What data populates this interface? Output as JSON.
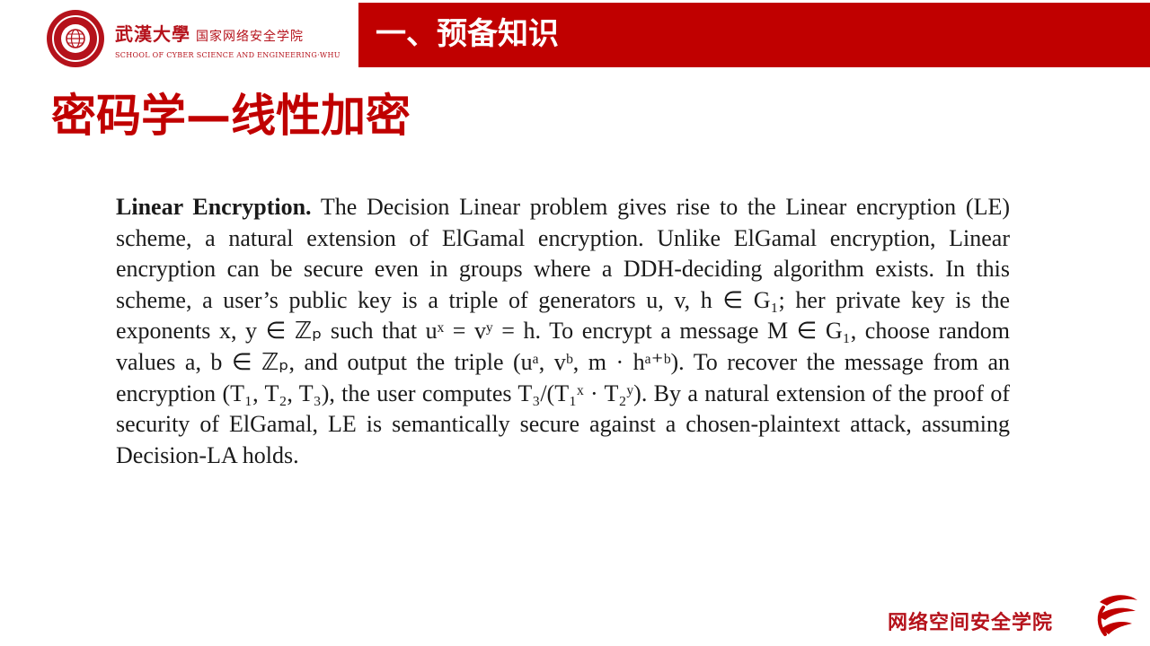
{
  "header": {
    "university_cn": "武漢大學",
    "institute_cn": "国家网络安全学院",
    "school_en": "SCHOOL OF CYBER SCIENCE AND ENGINEERING·WHU",
    "section_title": "一、预备知识"
  },
  "slide": {
    "title": "密码学—线性加密"
  },
  "body": {
    "bold_lead": "Linear Encryption.",
    "sentences": [
      "The Decision Linear problem gives rise to the Linear encryption (LE) scheme, a natural extension of ElGamal encryption.",
      "Unlike ElGamal encryption, Linear encryption can be secure even in groups where a DDH-deciding algorithm exists.",
      "In this scheme, a user’s public key is a triple of generators u, v, h ∈ G₁; her private key is the exponents x, y ∈ ℤₚ such that uˣ = vʸ = h.",
      "To encrypt a message M ∈ G₁, choose random values a, b ∈ ℤₚ, and output the triple (uᵃ, vᵇ, m · hᵃ⁺ᵇ).",
      "To recover the message from an encryption (T₁, T₂, T₃), the user computes T₃/(T₁ˣ · T₂ʸ).",
      "By a natural extension of the proof of security of ElGamal, LE is semantically secure against a chosen-plaintext attack, assuming Decision-LA holds."
    ]
  },
  "footer": {
    "text": "网络空间安全学院"
  },
  "colors": {
    "brand_red": "#c00000",
    "logo_red": "#b5121b",
    "text": "#1a1a1a"
  },
  "icons": {
    "university_seal": "whu-seal-logo",
    "footer_logo": "cyber-school-logo"
  }
}
